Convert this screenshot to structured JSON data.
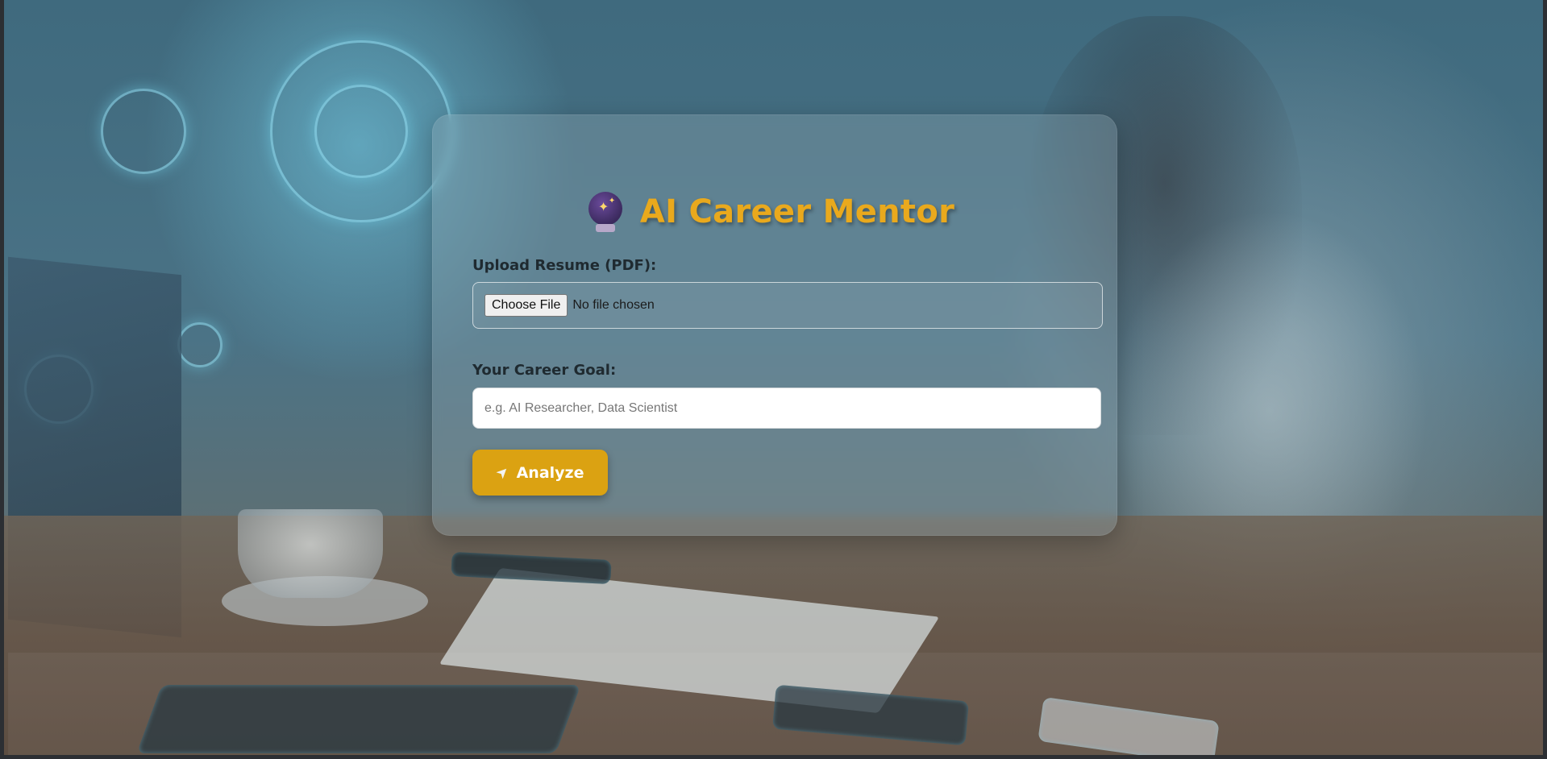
{
  "app": {
    "title": "AI Career Mentor",
    "title_icon": "crystal-ball-icon",
    "accent_color": "#e9a91d"
  },
  "form": {
    "resume_label": "Upload Resume (PDF):",
    "file_button_label": "Choose File",
    "file_status": "No file chosen",
    "goal_label": "Your Career Goal:",
    "goal_placeholder": "e.g. AI Researcher, Data Scientist",
    "goal_value": "",
    "submit_icon": "rocket-icon",
    "submit_label": "Analyze",
    "submit_color": "#dba212"
  }
}
